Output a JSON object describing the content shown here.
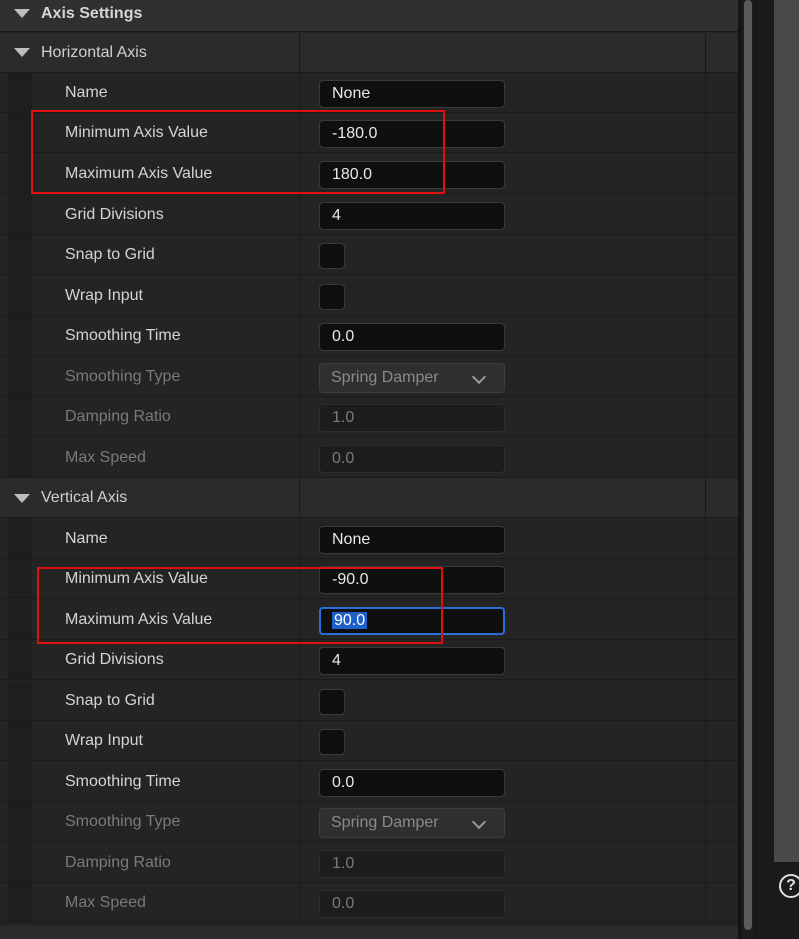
{
  "header": {
    "title": "Axis Settings"
  },
  "horizontal": {
    "label": "Horizontal Axis",
    "name_label": "Name",
    "name_value": "None",
    "min_label": "Minimum Axis Value",
    "min_value": "-180.0",
    "max_label": "Maximum Axis Value",
    "max_value": "180.0",
    "grid_label": "Grid Divisions",
    "grid_value": "4",
    "snap_label": "Snap to Grid",
    "wrap_label": "Wrap Input",
    "smooth_time_label": "Smoothing Time",
    "smooth_time_value": "0.0",
    "smooth_type_label": "Smoothing Type",
    "smooth_type_value": "Spring Damper",
    "damping_label": "Damping Ratio",
    "damping_value": "1.0",
    "max_speed_label": "Max Speed",
    "max_speed_value": "0.0"
  },
  "vertical": {
    "label": "Vertical Axis",
    "name_label": "Name",
    "name_value": "None",
    "min_label": "Minimum Axis Value",
    "min_value": "-90.0",
    "max_label": "Maximum Axis Value",
    "max_value": "90.0",
    "grid_label": "Grid Divisions",
    "grid_value": "4",
    "snap_label": "Snap to Grid",
    "wrap_label": "Wrap Input",
    "smooth_time_label": "Smoothing Time",
    "smooth_time_value": "0.0",
    "smooth_type_label": "Smoothing Type",
    "smooth_type_value": "Spring Damper",
    "damping_label": "Damping Ratio",
    "damping_value": "1.0",
    "max_speed_label": "Max Speed",
    "max_speed_value": "0.0"
  },
  "help": {
    "glyph": "?"
  },
  "colors": {
    "highlight_box": "#e01010",
    "focus": "#2a6fd6"
  }
}
